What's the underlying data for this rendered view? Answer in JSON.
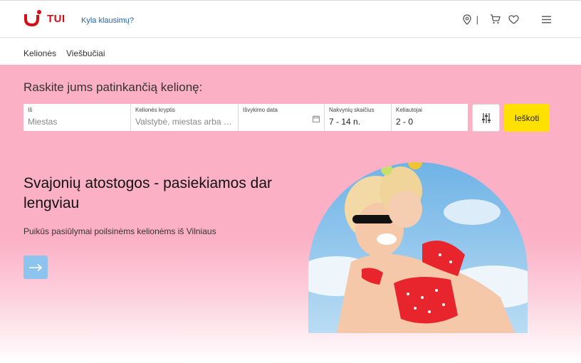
{
  "header": {
    "logo_text": "TUI",
    "help_link": "Kyla klausimų?",
    "icons": [
      "location-icon",
      "cart-icon",
      "heart-icon",
      "menu-icon"
    ],
    "separator": "|"
  },
  "nav": {
    "items": [
      {
        "label": "Kelionės"
      },
      {
        "label": "Viešbučiai"
      }
    ]
  },
  "search": {
    "title": "Raskite jums patinkančią kelionę:",
    "fields": [
      {
        "label": "Iš",
        "placeholder": "Miestas",
        "value": ""
      },
      {
        "label": "Kelionės kryptis",
        "placeholder": "Valstybė, miestas arba viešbutis",
        "value": ""
      },
      {
        "label": "Išvykimo data",
        "placeholder": "",
        "value": ""
      },
      {
        "label": "Nakvynių skaičius",
        "value": "7 - 14 n."
      },
      {
        "label": "Keliautojai",
        "value": "2 - 0"
      }
    ],
    "submit_label": "Ieškoti"
  },
  "promo": {
    "title": "Svajonių atostogos - pasiekiamos dar lengviau",
    "subtitle": "Puikūs pasiūlymai poilsinėms kelionėms iš Vilniaus"
  },
  "colors": {
    "brand_red": "#d40e14",
    "hero_pink": "#fbb0c5",
    "search_yellow": "#ffe100",
    "arrow_blue": "#8cc4ee",
    "link_blue": "#1a64b8"
  }
}
